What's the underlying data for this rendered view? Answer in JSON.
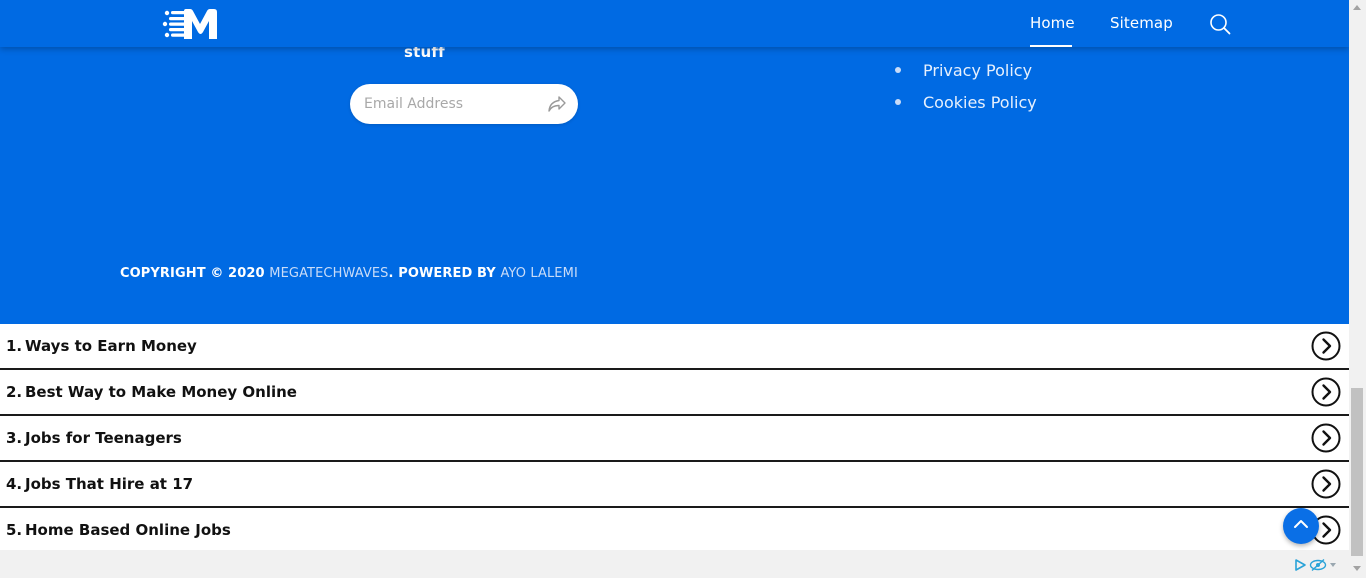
{
  "header": {
    "nav": {
      "home": "Home",
      "sitemap": "Sitemap"
    }
  },
  "footer": {
    "subscribe_text": "stuff",
    "email_placeholder": "Email Address",
    "links": [
      "Privacy Policy",
      "Cookies Policy"
    ],
    "copyright_prefix": "COPYRIGHT © 2020 ",
    "site_name": "MEGATECHWAVES",
    "powered_by": ". POWERED BY ",
    "author": "AYO LALEMI"
  },
  "related_searches": [
    {
      "num": "1.",
      "text": "Ways to Earn Money"
    },
    {
      "num": "2.",
      "text": "Best Way to Make Money Online"
    },
    {
      "num": "3.",
      "text": "Jobs for Teenagers"
    },
    {
      "num": "4.",
      "text": "Jobs That Hire at 17"
    },
    {
      "num": "5.",
      "text": "Home Based Online Jobs"
    }
  ],
  "colors": {
    "brand_blue": "#006ae3",
    "link_muted": "#c9dcf8",
    "row_border": "#1a1a1a"
  },
  "icons": {
    "logo": "megatechwaves-logo",
    "search": "search-icon",
    "send": "send-icon",
    "row_arrow": "chevron-right-circle-icon",
    "back_to_top": "chevron-up-icon",
    "adchoices": "adchoices-icon"
  }
}
